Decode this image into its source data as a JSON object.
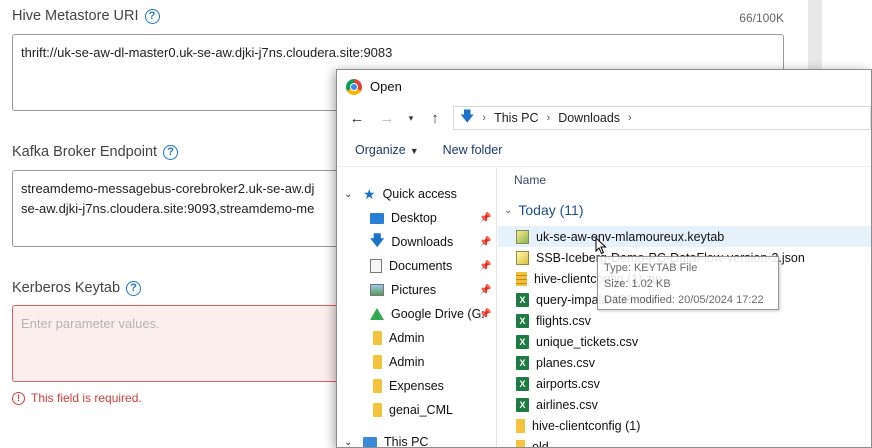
{
  "form": {
    "hive": {
      "label": "Hive Metastore URI",
      "counter": "66/100K",
      "value": "thrift://uk-se-aw-dl-master0.uk-se-aw.djki-j7ns.cloudera.site:9083"
    },
    "kafka": {
      "label": "Kafka Broker Endpoint",
      "line1": "streamdemo-messagebus-corebroker2.uk-se-aw.dj",
      "line2": "se-aw.djki-j7ns.cloudera.site:9093,streamdemo-me"
    },
    "keytab": {
      "label": "Kerberos Keytab",
      "placeholder": "Enter parameter values.",
      "error": "This field is required."
    },
    "help_glyph": "?",
    "error_glyph": "!"
  },
  "dialog": {
    "title": "Open",
    "breadcrumb": [
      "This PC",
      "Downloads"
    ],
    "toolbar": {
      "organize": "Organize",
      "new_folder": "New folder"
    },
    "nav_items": [
      {
        "label": "Quick access",
        "icon": "star-icon"
      },
      {
        "label": "Desktop",
        "icon": "desktop-icon"
      },
      {
        "label": "Downloads",
        "icon": "download-icon"
      },
      {
        "label": "Documents",
        "icon": "document-icon"
      },
      {
        "label": "Pictures",
        "icon": "picture-icon"
      },
      {
        "label": "Google Drive (G:",
        "icon": "google-drive-icon"
      },
      {
        "label": "Admin",
        "icon": "folder-icon"
      },
      {
        "label": "Admin",
        "icon": "folder-icon"
      },
      {
        "label": "Expenses",
        "icon": "folder-icon"
      },
      {
        "label": "genai_CML",
        "icon": "folder-icon"
      },
      {
        "label": "This PC",
        "icon": "computer-icon"
      }
    ],
    "column_name": "Name",
    "group": "Today (11)",
    "files": [
      {
        "name": "uk-se-aw-env-mlamoureux.keytab",
        "icon": "keytab-icon"
      },
      {
        "name": "SSB-Iceberg-Demo-PC-DataFlow-version-2.json",
        "icon": "json-icon"
      },
      {
        "name": "hive-clientconfig (1).zip",
        "icon": "zip-icon"
      },
      {
        "name": "query-impala-136.csv",
        "icon": "csv-icon"
      },
      {
        "name": "flights.csv",
        "icon": "csv-icon"
      },
      {
        "name": "unique_tickets.csv",
        "icon": "csv-icon"
      },
      {
        "name": "planes.csv",
        "icon": "csv-icon"
      },
      {
        "name": "airports.csv",
        "icon": "csv-icon"
      },
      {
        "name": "airlines.csv",
        "icon": "csv-icon"
      },
      {
        "name": "hive-clientconfig (1)",
        "icon": "folder-icon"
      },
      {
        "name": "old",
        "icon": "folder-icon"
      }
    ],
    "tooltip": {
      "type": "Type: KEYTAB File",
      "size": "Size: 1.02 KB",
      "modified": "Date modified: 20/05/2024 17:22"
    },
    "csv_glyph": "X"
  }
}
